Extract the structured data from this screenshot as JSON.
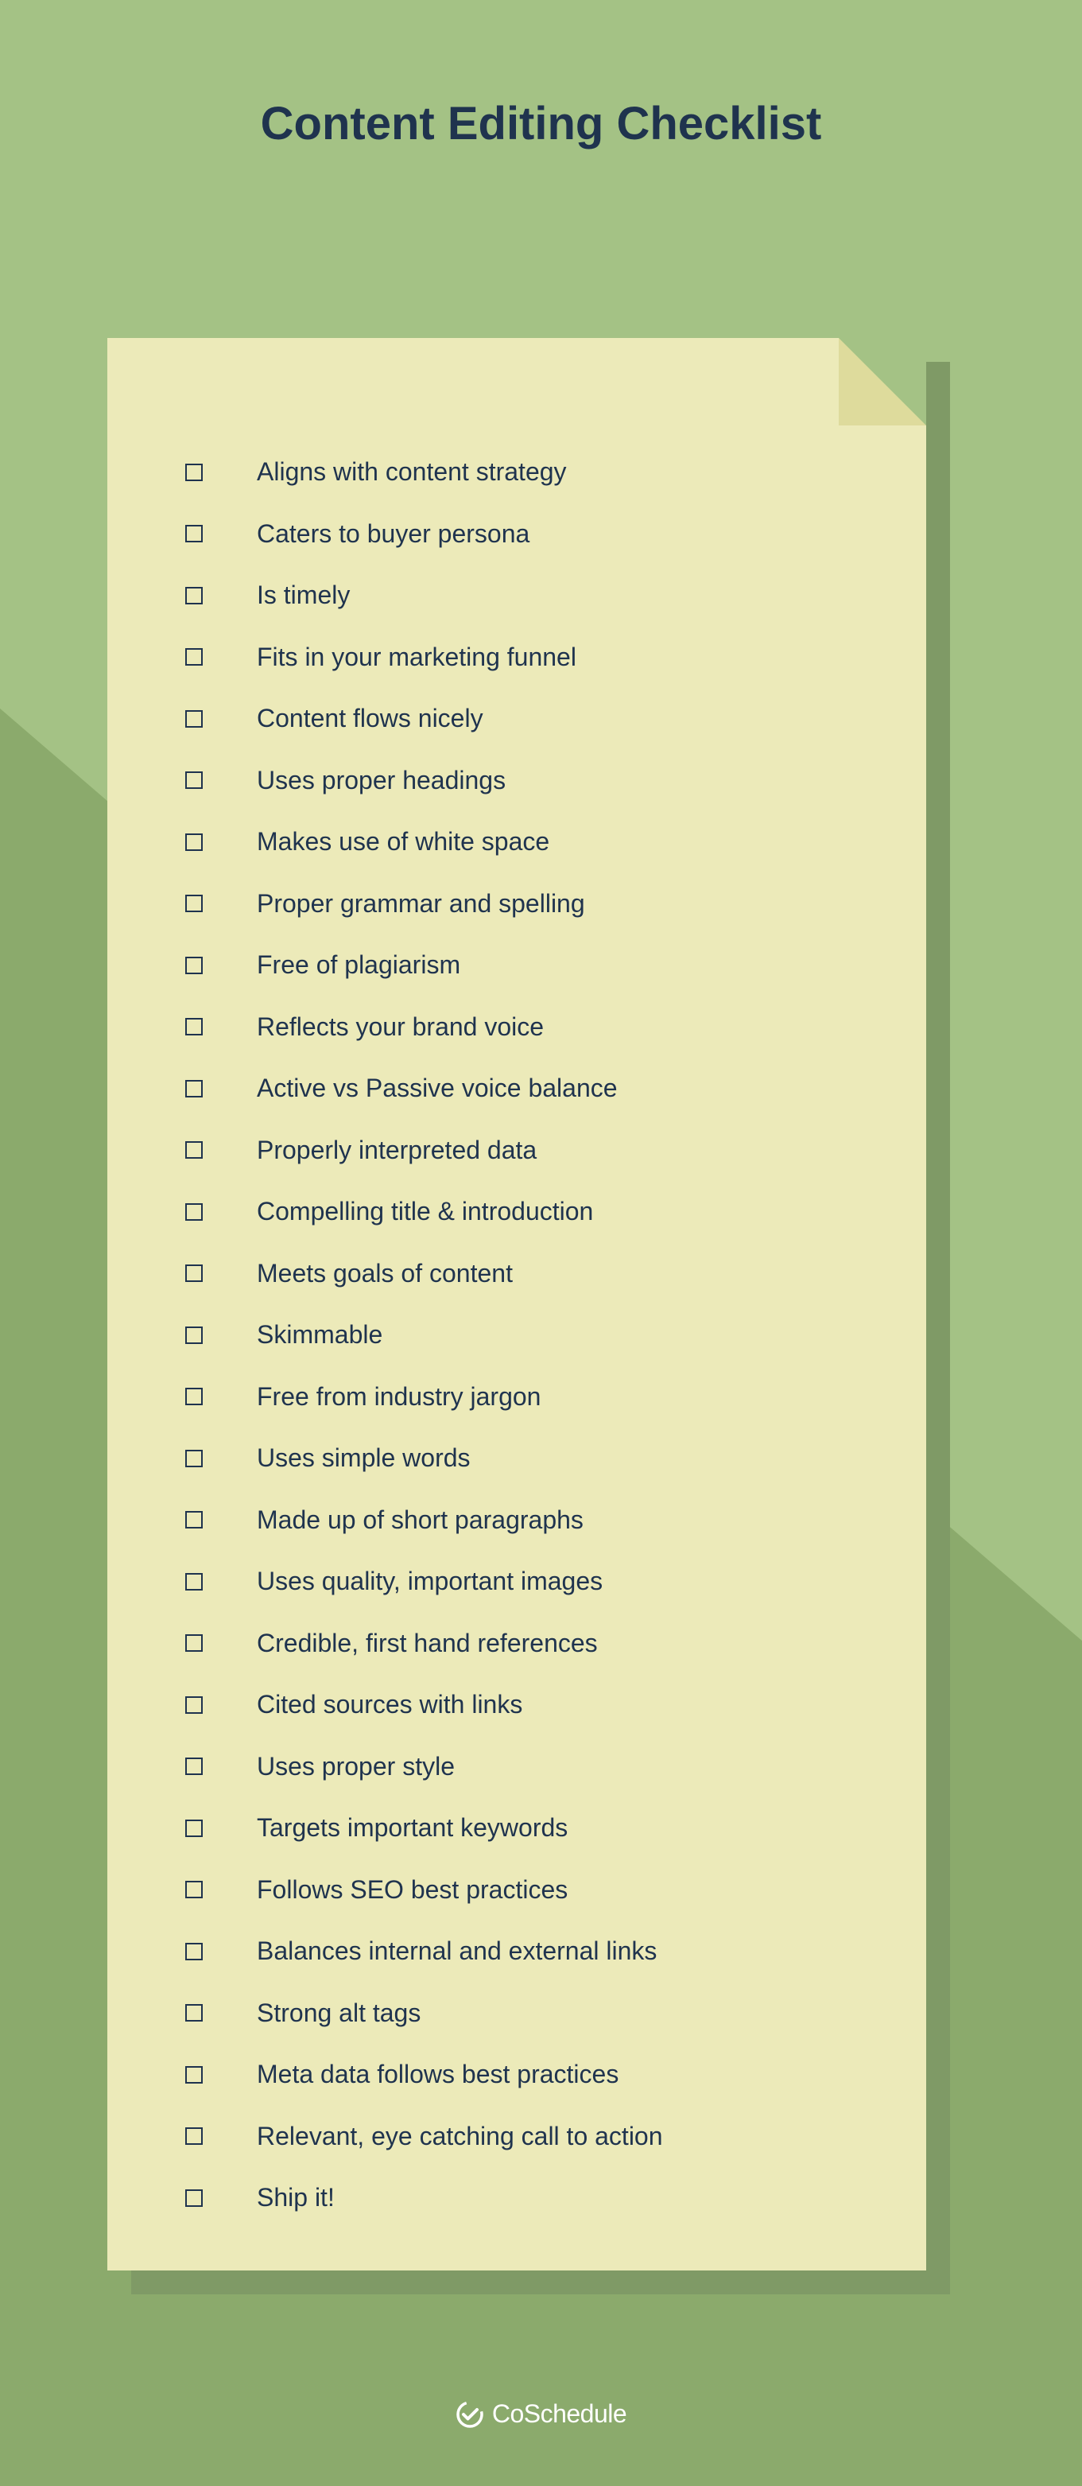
{
  "title": "Content Editing Checklist",
  "checklist": {
    "items": [
      "Aligns with content strategy",
      "Caters to buyer persona",
      "Is timely",
      "Fits in your marketing funnel",
      "Content flows nicely",
      "Uses proper headings",
      "Makes use of white space",
      "Proper grammar and spelling",
      "Free of plagiarism",
      "Reflects your brand voice",
      "Active vs Passive voice balance",
      "Properly interpreted data",
      "Compelling title & introduction",
      "Meets goals of content",
      "Skimmable",
      "Free from industry jargon",
      "Uses simple words",
      "Made up of short paragraphs",
      "Uses quality, important images",
      "Credible, first hand references",
      "Cited sources with links",
      "Uses proper style",
      "Targets important keywords",
      "Follows SEO best practices",
      "Balances internal and external links",
      "Strong alt tags",
      "Meta data follows best practices",
      "Relevant, eye catching call to action",
      "Ship it!"
    ]
  },
  "brand": "CoSchedule"
}
